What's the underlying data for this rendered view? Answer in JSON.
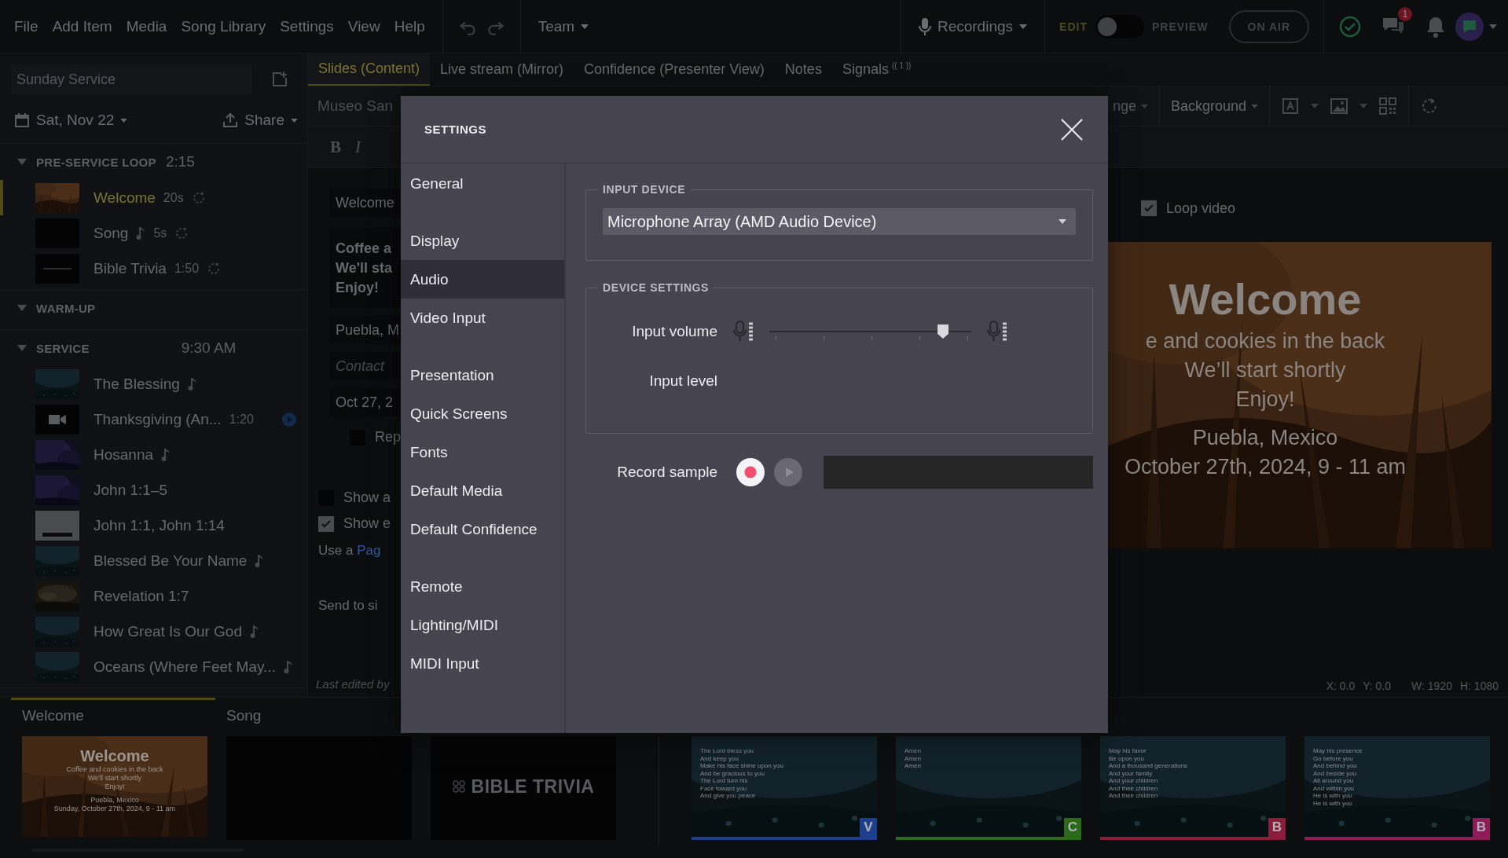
{
  "menu": [
    "File",
    "Add Item",
    "Media",
    "Song Library",
    "Settings",
    "View",
    "Help"
  ],
  "team": "Team",
  "recordings": "Recordings",
  "mode": {
    "edit": "EDIT",
    "preview": "PREVIEW",
    "preview_on": false
  },
  "on_air": "ON AIR",
  "chat_badge": "1",
  "plan": {
    "title": "Sunday Service",
    "date": "Sat, Nov 22",
    "share": "Share"
  },
  "sections": [
    {
      "name": "PRE-SERVICE LOOP",
      "time": "2:15",
      "expanded": true,
      "items": [
        {
          "title": "Welcome",
          "kind": "picture",
          "music": false,
          "duration": "20s",
          "loop": true,
          "video_play": false,
          "selected": true
        },
        {
          "title": "Song",
          "kind": "blank",
          "music": true,
          "duration": "5s",
          "loop": true,
          "video_play": false,
          "selected": false
        },
        {
          "title": "Bible Trivia",
          "kind": "title",
          "music": false,
          "duration": "1:50",
          "loop": true,
          "video_play": false,
          "selected": false
        }
      ]
    },
    {
      "name": "WARM-UP",
      "expanded": true
    },
    {
      "name": "SERVICE",
      "time": "9:30 AM",
      "expanded": true,
      "items": [
        {
          "title": "The Blessing",
          "kind": "picture",
          "music": true,
          "loop": false,
          "video_play": false,
          "selected": false
        },
        {
          "title": "Thanksgiving (An...",
          "kind": "video",
          "music": false,
          "duration": "1:20",
          "loop": false,
          "video_play": true,
          "selected": false
        },
        {
          "title": "Hosanna",
          "kind": "picture",
          "music": true,
          "loop": false,
          "video_play": false,
          "selected": false
        },
        {
          "title": "John 1:1–5",
          "kind": "picture",
          "music": false,
          "loop": false,
          "video_play": false,
          "selected": false
        },
        {
          "title": "John 1:1, John 1:14",
          "kind": "card",
          "music": false,
          "loop": false,
          "video_play": false,
          "selected": false
        },
        {
          "title": "Blessed Be Your Name",
          "kind": "picture",
          "music": true,
          "loop": false,
          "video_play": false,
          "selected": false
        },
        {
          "title": "Revelation 1:7",
          "kind": "picture",
          "music": false,
          "loop": false,
          "video_play": false,
          "selected": false
        },
        {
          "title": "How Great Is Our God",
          "kind": "picture",
          "music": true,
          "loop": false,
          "video_play": false,
          "selected": false
        },
        {
          "title": "Oceans (Where Feet May...",
          "kind": "picture",
          "music": true,
          "loop": false,
          "video_play": false,
          "selected": false
        }
      ]
    }
  ],
  "editor_tabs": [
    {
      "label": "Slides (Content)",
      "selected": true
    },
    {
      "label": "Live stream (Mirror)",
      "selected": false
    },
    {
      "label": "Confidence (Presenter View)",
      "selected": false
    },
    {
      "label": "Notes",
      "selected": false
    },
    {
      "label": "Signals",
      "selected": false,
      "badge": "(( 1 ))"
    }
  ],
  "editor": {
    "font": "Museo San",
    "format_buttons": [
      "B",
      "I"
    ],
    "title_field": "Welcome",
    "body_lines": [
      "Coffee a",
      "We'll sta",
      "Enjoy!"
    ],
    "location_field": "Puebla, M",
    "contact_placeholder": "Contact",
    "date_field": "Oct 27, 2",
    "repeat_option": {
      "label": "Rep",
      "checked": false
    },
    "show_options": [
      {
        "label": "Show a",
        "checked": false
      },
      {
        "label": "Show e",
        "checked": true
      }
    ],
    "use_text": "Use a ",
    "use_link": "Pag",
    "send_text": "Send to si",
    "last_edited": "Last edited by"
  },
  "preview": {
    "cut_dropdown": "nge",
    "background": "Background",
    "loop_video": {
      "label": "Loop video",
      "checked": true
    },
    "slide": {
      "title": "Welcome",
      "lines": [
        "e and cookies in the back",
        "We’ll start shortly",
        "Enjoy!"
      ],
      "location": "Puebla, Mexico",
      "date": "October 27th, 2024, 9 - 11 am"
    },
    "status": [
      "X: 0.0",
      "Y: 0.0",
      "W: 1920",
      "H: 1080"
    ]
  },
  "strip": {
    "tabs": [
      {
        "label": "Welcome",
        "selected": true
      },
      {
        "label": "Song",
        "selected": false
      }
    ],
    "slides": [
      {
        "kind": "welcome",
        "title": "Welcome",
        "lines": [
          "Coffee and cookies in the back",
          "We'll start shortly",
          "Enjoy!"
        ],
        "location": "Puebla, Mexico",
        "date": "Sunday, October 27th, 2024, 9 - 11 am"
      },
      {
        "kind": "blank"
      },
      {
        "kind": "title",
        "text": "BIBLE TRIVIA"
      },
      {
        "kind": "lyrics",
        "lines": [
          "The Lord bless you",
          "And keep you",
          "Make his face shine upon you",
          "And be gracious to you",
          "The Lord turn his",
          "Face toward you",
          "And give you peace"
        ],
        "badge": "V",
        "color": "#1d3f8c"
      },
      {
        "kind": "lyrics",
        "lines": [
          "Amen",
          "Amen",
          "Amen"
        ],
        "badge": "C",
        "color": "#2c6a1b"
      },
      {
        "kind": "lyrics",
        "lines": [
          "May his favor",
          "Be upon you",
          "And a thousand generations",
          "And your family",
          "And your children",
          "And their children",
          "And their children"
        ],
        "badge": "B",
        "color": "#8a1c3c"
      },
      {
        "kind": "lyrics",
        "lines": [
          "May his presence",
          "Go before you",
          "And behind you",
          "And beside you",
          "All around you",
          "And within you",
          "He is with you",
          "He is with you"
        ],
        "badge": "B",
        "color": "#8c1d58"
      }
    ]
  },
  "dialog": {
    "title": "SETTINGS",
    "nav_groups": [
      {
        "items": [
          {
            "label": "General",
            "selected": false
          }
        ]
      },
      {
        "items": [
          {
            "label": "Display",
            "selected": false
          },
          {
            "label": "Audio",
            "selected": true
          },
          {
            "label": "Video Input",
            "selected": false
          }
        ]
      },
      {
        "items": [
          {
            "label": "Presentation",
            "selected": false
          },
          {
            "label": "Quick Screens",
            "selected": false
          },
          {
            "label": "Fonts",
            "selected": false
          },
          {
            "label": "Default Media",
            "selected": false
          },
          {
            "label": "Default Confidence",
            "selected": false
          }
        ]
      },
      {
        "items": [
          {
            "label": "Remote",
            "selected": false
          },
          {
            "label": "Lighting/MIDI",
            "selected": false
          },
          {
            "label": "MIDI Input",
            "selected": false
          }
        ]
      }
    ],
    "input_device": {
      "legend": "INPUT DEVICE",
      "value": "Microphone Array (AMD Audio Device)"
    },
    "device_settings": {
      "legend": "DEVICE SETTINGS",
      "volume_label": "Input volume",
      "level": 0.86,
      "level_label": "Input level"
    },
    "record": {
      "label": "Record sample",
      "play_disabled": true
    }
  }
}
